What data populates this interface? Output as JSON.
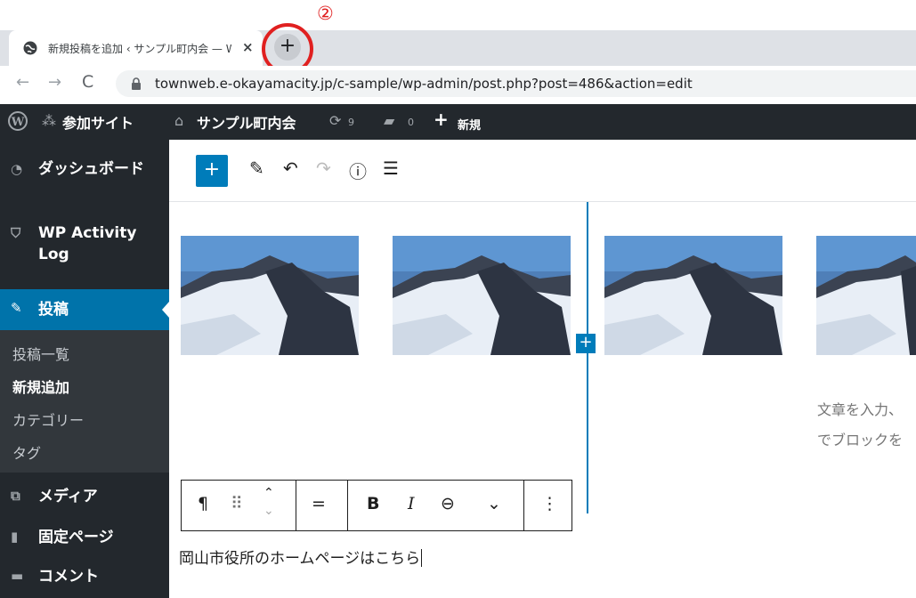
{
  "annotation": {
    "number_label": "②"
  },
  "browser": {
    "tab": {
      "title": "新規投稿を追加 ‹ サンプル町内会 — WordPress",
      "close_glyph": "×"
    },
    "new_tab_glyph": "+",
    "nav": {
      "back": "←",
      "forward": "→",
      "reload": "C"
    },
    "url": "townweb.e-okayamacity.jp/c-sample/wp-admin/post.php?post=486&action=edit"
  },
  "adminbar": {
    "wp_logo": "wordpress-logo",
    "my_sites": "参加サイト",
    "site_name": "サンプル町内会",
    "updates_count": "9",
    "comments_count": "0",
    "new_label": "新規"
  },
  "sidebar": {
    "items": [
      {
        "label": "ダッシュボード",
        "icon": "dashboard-icon"
      },
      {
        "label_line1": "WP Activity",
        "label_line2": "Log",
        "icon": "shield-icon"
      },
      {
        "label": "投稿",
        "icon": "pin-icon",
        "active": true
      },
      {
        "label": "メディア",
        "icon": "media-icon"
      },
      {
        "label": "固定ページ",
        "icon": "pages-icon"
      },
      {
        "label": "コメント",
        "icon": "comment-icon"
      }
    ],
    "submenu": [
      "投稿一覧",
      "新規追加",
      "カテゴリー",
      "タグ"
    ],
    "submenu_current": "新規追加"
  },
  "editor": {
    "toolbar": [
      "add-block",
      "edit-tool",
      "undo",
      "redo",
      "info",
      "outline"
    ],
    "placeholder_line1": "文章を入力、",
    "placeholder_line2": "でブロックを",
    "block_toolbar": {
      "paragraph": "¶",
      "drag": "⠿",
      "align": "=",
      "bold": "B",
      "italic": "I",
      "link": "⊖",
      "more": "⌄",
      "options": "⋮"
    },
    "paragraph_text": "岡山市役所のホームページはこちら"
  },
  "colors": {
    "accent": "#007cba",
    "admin_bg": "#23282d",
    "highlight_ring": "#e02020"
  }
}
